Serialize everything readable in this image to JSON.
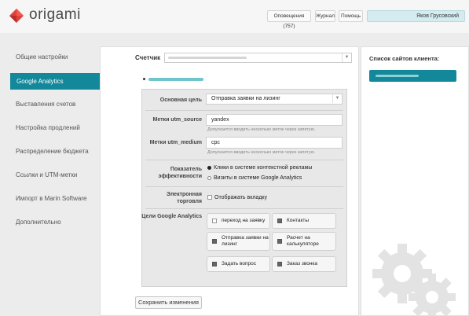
{
  "app": {
    "logo_text": "origami"
  },
  "header": {
    "notifications": "Оповещения (757)",
    "journal": "Журнал",
    "help": "Помощь",
    "user_name": "Яков Грусовский"
  },
  "sidebar": {
    "items": [
      {
        "label": "Общие настройки"
      },
      {
        "label": "Google Analytics"
      },
      {
        "label": "Выставления счетов"
      },
      {
        "label": "Настройка продлений"
      },
      {
        "label": "Распределение бюджета"
      },
      {
        "label": "Ссылки и UTM-метки"
      },
      {
        "label": "Импорт в Marin Software"
      },
      {
        "label": "Дополнительно"
      }
    ],
    "active_index": 1
  },
  "main": {
    "counter_label": "Счетчик",
    "form": {
      "main_goal_label": "Основная цель",
      "main_goal_value": "Отправка заявки на лизинг",
      "utm_source_label": "Метки utm_source",
      "utm_source_value": "yandex",
      "utm_source_hint": "Допускается вводить несколько меток через запятую.",
      "utm_medium_label": "Метки utm_medium",
      "utm_medium_value": "cpc",
      "utm_medium_hint": "Допускается вводить несколько меток через запятую.",
      "metric_label": "Показатель эффективности",
      "metric_options": [
        {
          "label": "Клики в системе контекстной рекламы",
          "selected": true
        },
        {
          "label": "Визиты в системе Google Analytics",
          "selected": false
        }
      ],
      "ecommerce_label": "Электронная торговля",
      "ecommerce_checkbox": "Отображать вкладку",
      "ga_goals_label": "Цели Google Analytics",
      "goals": [
        {
          "label": "переход на заявку",
          "checked": false
        },
        {
          "label": "Контакты",
          "checked": true
        },
        {
          "label": "Отправка заявки на лизинг",
          "checked": true
        },
        {
          "label": "Расчет на калькуляторе",
          "checked": true
        },
        {
          "label": "Задать вопрос",
          "checked": true
        },
        {
          "label": "Заказ звонка",
          "checked": true
        }
      ]
    },
    "save_button": "Сохранить изменения"
  },
  "right_panel": {
    "title": "Список сайтов клиента:"
  },
  "colors": {
    "accent": "#12889a",
    "panel_bg": "#e8e8e8",
    "page_bg": "#ececec"
  }
}
